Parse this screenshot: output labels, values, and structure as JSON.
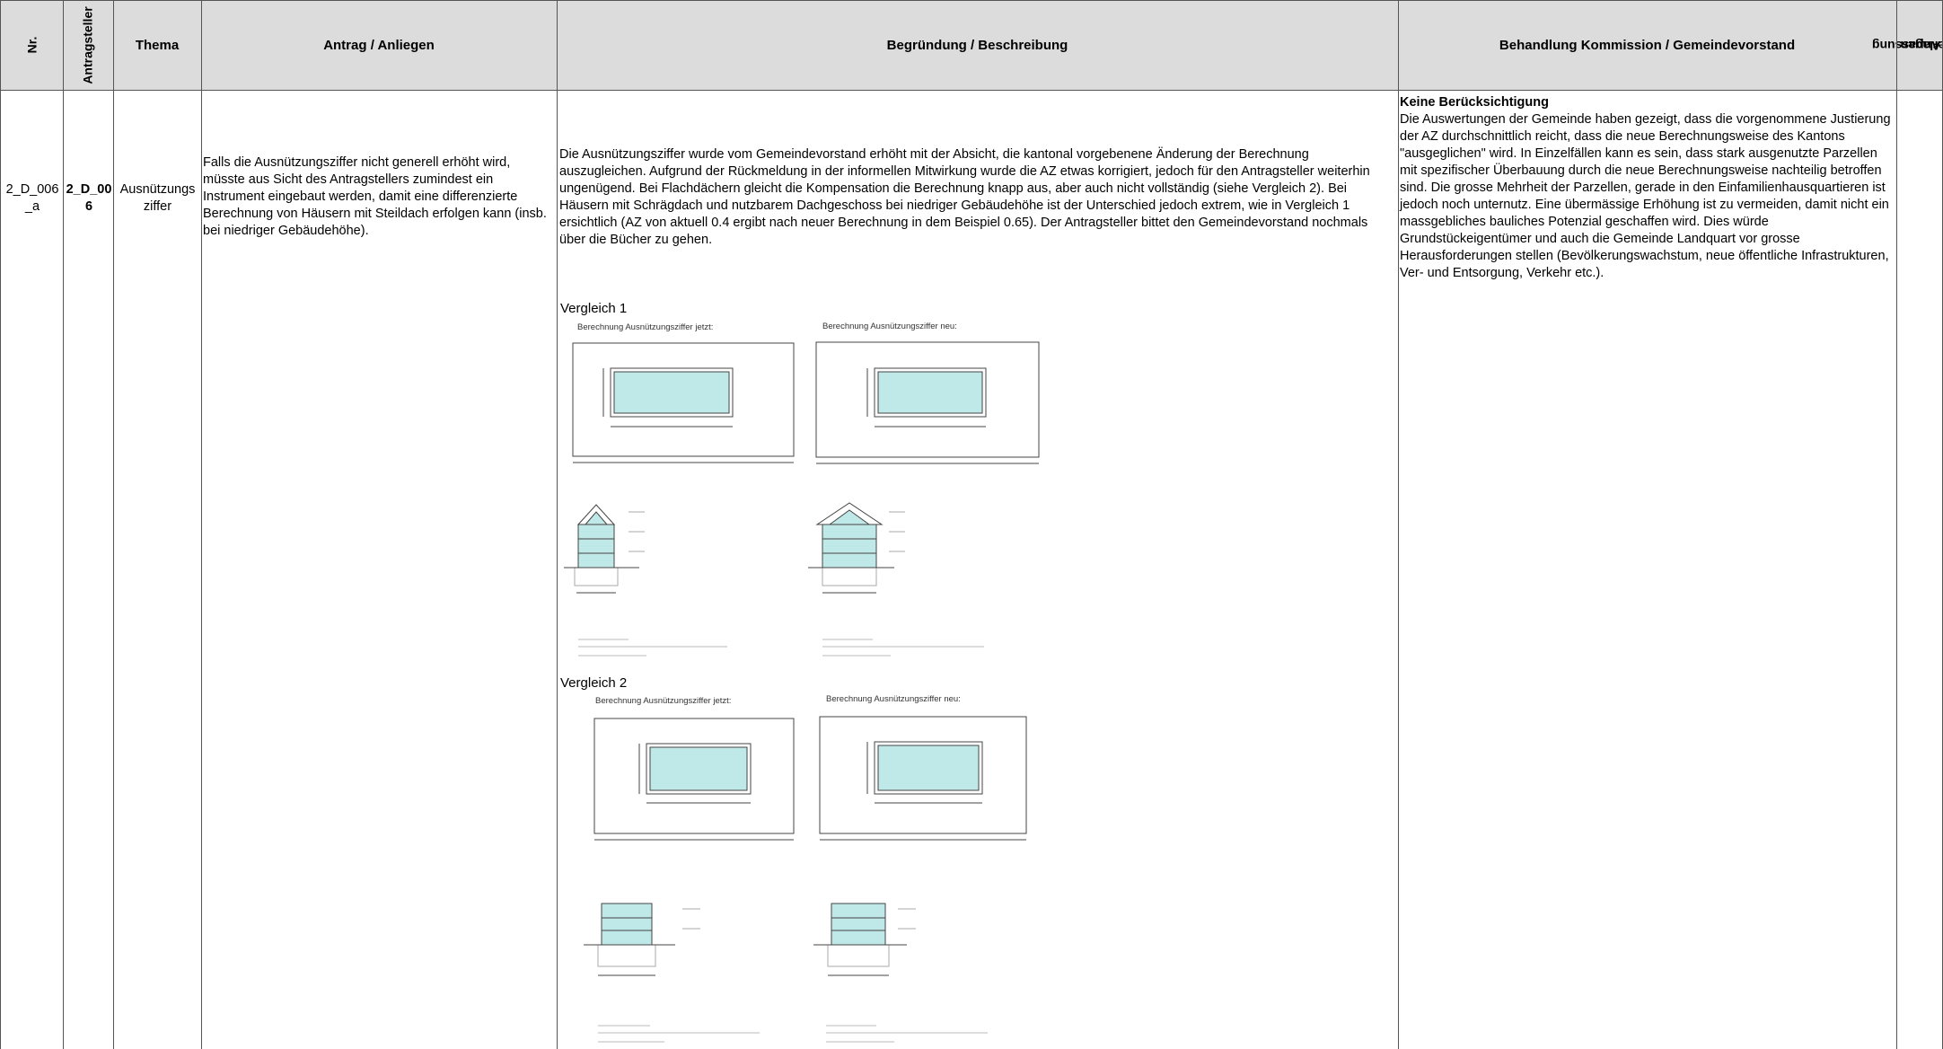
{
  "header": {
    "nr": "Nr.",
    "antragsteller": "Antragsteller",
    "thema": "Thema",
    "antrag": "Antrag / Anliegen",
    "begruendung": "Begründung / Beschreibung",
    "behandlung": "Behandlung Kommission / Gemeindevorstand",
    "anpassung_line1": "Anpassung",
    "anpassung_line2": "Unterlagen"
  },
  "row": {
    "nr_line1": "2_D_006",
    "nr_line2": "_a",
    "antragsteller_line1": "2_D_00",
    "antragsteller_line2": "6",
    "thema_line1": "Ausnützungs",
    "thema_line2": "ziffer",
    "antrag": "Falls die Ausnützungsziffer nicht generell erhöht wird, müsste aus Sicht des Antragstellers zumindest ein Instrument eingebaut werden, damit eine differenzierte Berechnung von Häusern mit Steildach erfolgen kann (insb. bei niedriger Gebäudehöhe).",
    "begruendung": "Die Ausnützungsziffer wurde vom Gemeindevorstand erhöht mit der Absicht, die kantonal vorgebenene Änderung der Berechnung auszugleichen. Aufgrund der Rückmeldung in der informellen Mitwirkung wurde die AZ etwas korrigiert, jedoch für den Antragsteller weiterhin ungenügend. Bei Flachdächern gleicht die Kompensation die Berechnung knapp aus, aber auch nicht vollständig (siehe Vergleich 2). Bei Häusern mit Schrägdach und nutzbarem Dachgeschoss bei niedriger Gebäudehöhe ist der Unterschied jedoch extrem, wie in Vergleich 1 ersichtlich (AZ von aktuell 0.4 ergibt nach neuer Berechnung in dem Beispiel 0.65).  Der Antragsteller bittet den Gemeindevorstand nochmals über die Bücher zu gehen.",
    "behandlung_title": "Keine Berücksichtigung",
    "behandlung_text": "Die Auswertungen der Gemeinde haben gezeigt, dass die vorgenommene Justierung der AZ durchschnittlich reicht, dass die neue Berechnungsweise des Kantons \"ausgeglichen\" wird. In Einzelfällen kann es sein, dass stark ausgenutzte Parzellen mit spezifischer Überbauung durch die neue Berechnungsweise nachteilig betroffen sind. Die grosse Mehrheit der Parzellen, gerade in den Einfamilienhausquartieren ist jedoch noch unternutz. Eine übermässige Erhöhung ist zu vermeiden, damit nicht ein massgebliches bauliches Potenzial geschaffen wird. Dies würde Grundstückeigentümer und auch die Gemeinde Landquart vor grosse Herausforderungen stellen (Bevölkerungswachstum, neue öffentliche Infrastrukturen, Ver- und Entsorgung, Verkehr etc.)."
  },
  "figures": {
    "vergleich1": "Vergleich 1",
    "vergleich2": "Vergleich 2",
    "az_jetzt": "Berechnung Ausnützungsziffer jetzt:",
    "az_neu": "Berechnung Ausnützungsziffer neu:"
  },
  "colors": {
    "header_bg": "#dcdcdc",
    "building_fill": "#bfe8e8",
    "grid_line": "#555555"
  }
}
